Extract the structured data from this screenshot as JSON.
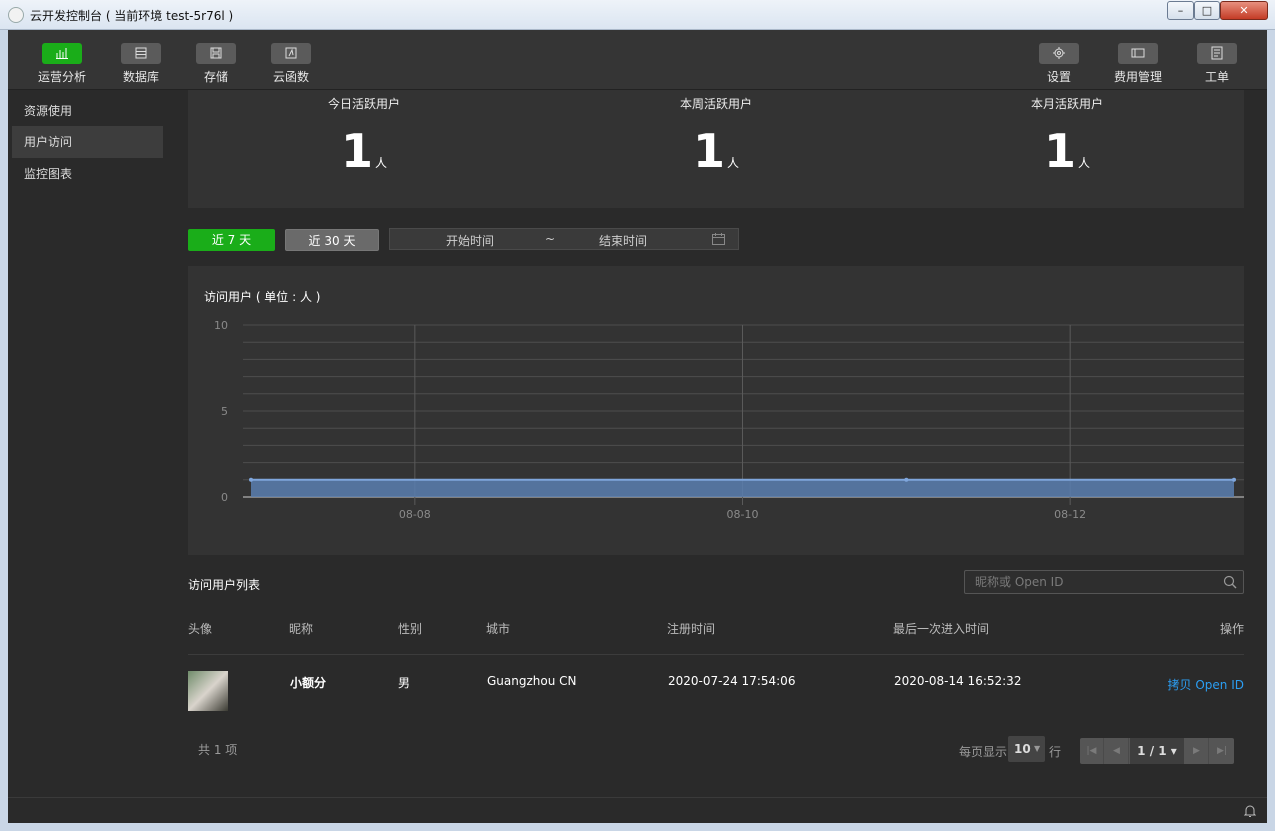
{
  "window": {
    "title": "云开发控制台 ( 当前环境 test-5r76l )"
  },
  "toolbar": {
    "left": [
      {
        "label": "运营分析",
        "icon": "bar-chart-icon"
      },
      {
        "label": "数据库",
        "icon": "database-icon"
      },
      {
        "label": "存储",
        "icon": "storage-icon"
      },
      {
        "label": "云函数",
        "icon": "function-icon"
      }
    ],
    "right": [
      {
        "label": "设置",
        "icon": "gear-icon"
      },
      {
        "label": "费用管理",
        "icon": "billing-icon"
      },
      {
        "label": "工单",
        "icon": "ticket-icon"
      }
    ]
  },
  "sidebar": {
    "items": [
      {
        "label": "资源使用"
      },
      {
        "label": "用户访问"
      },
      {
        "label": "监控图表"
      }
    ]
  },
  "stats": [
    {
      "label": "今日活跃用户",
      "value": "1",
      "unit": "人"
    },
    {
      "label": "本周活跃用户",
      "value": "1",
      "unit": "人"
    },
    {
      "label": "本月活跃用户",
      "value": "1",
      "unit": "人"
    }
  ],
  "filters": {
    "btn7": "近 7 天",
    "btn30": "近 30 天",
    "start": "开始时间",
    "tilde": "~",
    "end": "结束时间"
  },
  "chart_data": {
    "type": "area",
    "title": "访问用户 ( 单位 : 人 )",
    "x_ticks": [
      "08-08",
      "08-10",
      "08-12"
    ],
    "y_ticks": [
      "10",
      "5",
      "0"
    ],
    "ylim": [
      0,
      10
    ],
    "x": [
      "08-07",
      "08-08",
      "08-09",
      "08-10",
      "08-11",
      "08-12",
      "08-13"
    ],
    "values": [
      1,
      1,
      1,
      1,
      1,
      1,
      1
    ],
    "markers_at": [
      "08-07",
      "08-11",
      "08-13"
    ],
    "grid": true,
    "colors": {
      "fill": "#5b7fb0",
      "line": "#7fa6dc"
    }
  },
  "list": {
    "title": "访问用户列表",
    "search_placeholder": "昵称或 Open ID",
    "columns": [
      "头像",
      "昵称",
      "性别",
      "城市",
      "注册时间",
      "最后一次进入时间",
      "操作"
    ],
    "rows": [
      {
        "nickname": "小额分",
        "gender": "男",
        "city": "Guangzhou CN",
        "registered": "2020-07-24 17:54:06",
        "last_visit": "2020-08-14 16:52:32",
        "action": "拷贝 Open ID"
      }
    ]
  },
  "pagination": {
    "total": "共 1 项",
    "per_page_label": "每页显示",
    "per_page": "10",
    "row_label": "行",
    "current": "1 / 1"
  },
  "colors": {
    "accent": "#1aad19",
    "link": "#2b9ef3"
  }
}
